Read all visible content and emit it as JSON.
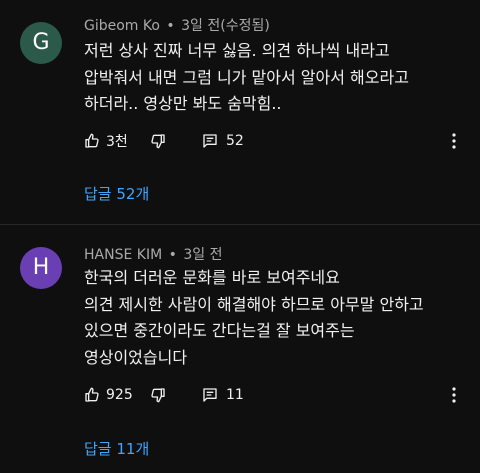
{
  "comments": [
    {
      "avatar_letter": "G",
      "avatar_color": "#2c5a4a",
      "author": "Gibeom Ko",
      "separator": "•",
      "time": "3일 전(수정됨)",
      "lines": [
        "저런 상사 진짜 너무 싫음. 의견 하나씩 내라고",
        "압박줘서 내면 그럼 니가 맡아서 알아서 해오라고",
        "하더라.. 영상만 봐도 숨막힘.."
      ],
      "likes": "3천",
      "reply_count": "52",
      "replies_link": "답글 52개"
    },
    {
      "avatar_letter": "H",
      "avatar_color": "#6a3fb4",
      "author": "HANSE KIM",
      "separator": "•",
      "time": "3일 전",
      "lines": [
        "한국의 더러운 문화를 바로 보여주네요",
        "의견 제시한 사람이 해결해야 하므로 아무말 안하고",
        "있으면 중간이라도 간다는걸 잘 보여주는",
        "영상이었습니다"
      ],
      "likes": "925",
      "reply_count": "11",
      "replies_link": "답글 11개"
    }
  ],
  "icons": {
    "like": "thumbs-up-icon",
    "dislike": "thumbs-down-icon",
    "reply": "comment-icon",
    "more": "more-vert-icon"
  },
  "colors": {
    "background": "#0f0f0f",
    "text": "#f1f1f1",
    "meta": "#aaaaaa",
    "link": "#3ea6ff",
    "divider": "#272727"
  }
}
